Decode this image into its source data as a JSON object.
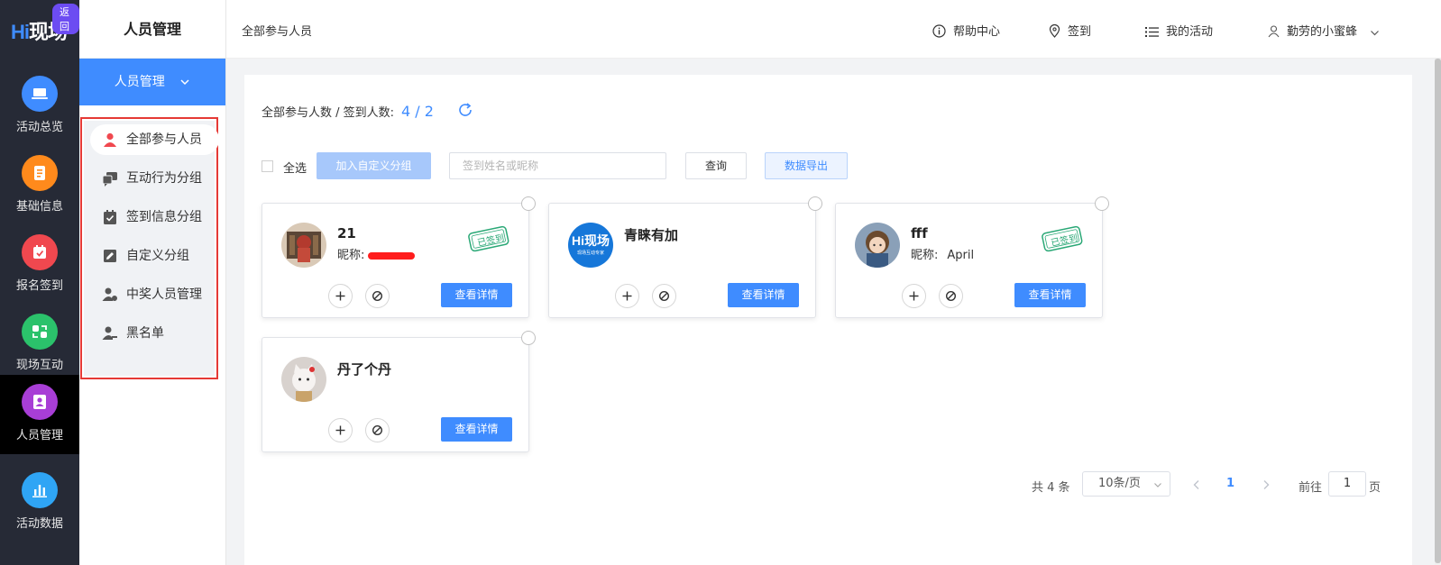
{
  "app": {
    "logo_hi": "Hi",
    "logo_rest": "现场",
    "back_label": "返回"
  },
  "rail": [
    {
      "label": "活动总览",
      "icon": "laptop-icon",
      "color": "#3f8cff"
    },
    {
      "label": "基础信息",
      "icon": "document-icon",
      "color": "#ff8a1c"
    },
    {
      "label": "报名签到",
      "icon": "calendar-check-icon",
      "color": "#f0484f"
    },
    {
      "label": "现场互动",
      "icon": "interaction-icon",
      "color": "#2bc26b"
    },
    {
      "label": "人员管理",
      "icon": "user-card-icon",
      "color": "#a83ed6",
      "active": true
    },
    {
      "label": "活动数据",
      "icon": "bar-chart-icon",
      "color": "#2fa5f5"
    }
  ],
  "submenu": {
    "title": "人员管理",
    "head": "人员管理",
    "items": [
      {
        "label": "全部参与人员",
        "icon": "user-icon",
        "active": true
      },
      {
        "label": "互动行为分组",
        "icon": "chat-group-icon"
      },
      {
        "label": "签到信息分组",
        "icon": "checkin-group-icon"
      },
      {
        "label": "自定义分组",
        "icon": "edit-group-icon"
      },
      {
        "label": "中奖人员管理",
        "icon": "prize-user-icon"
      },
      {
        "label": "黑名单",
        "icon": "blacklist-user-icon"
      }
    ]
  },
  "topbar": {
    "breadcrumb": "全部参与人员",
    "help": "帮助中心",
    "checkin": "签到",
    "my_activities": "我的活动",
    "user": "勤劳的小蜜蜂"
  },
  "stats": {
    "label": "全部参与人数 / 签到人数:",
    "value": "4 / 2"
  },
  "toolbar": {
    "select_all": "全选",
    "add_group": "加入自定义分组",
    "search_placeholder": "签到姓名或昵称",
    "query": "查询",
    "export": "数据导出"
  },
  "cards": [
    {
      "name": "21",
      "nick_label": "昵称:",
      "nick": "",
      "stamp": "已签到",
      "detail": "查看详情",
      "checked_in": true
    },
    {
      "name": "青睐有加",
      "nick_label": "",
      "nick": "",
      "stamp": "",
      "detail": "查看详情",
      "avatar_text": "Hi现场",
      "avatar_sub": "现场互动专家",
      "checked_in": false
    },
    {
      "name": "fff",
      "nick_label": "昵称:",
      "nick": "April",
      "stamp": "已签到",
      "detail": "查看详情",
      "checked_in": true
    },
    {
      "name": "丹了个丹",
      "nick_label": "",
      "nick": "",
      "stamp": "",
      "detail": "查看详情",
      "checked_in": false
    }
  ],
  "pager": {
    "total": "共 4 条",
    "page_size": "10条/页",
    "current": "1",
    "goto_label": "前往",
    "goto_value": "1",
    "page_suffix": "页"
  },
  "colors": {
    "primary": "#3f8cff",
    "rail_bg": "#262a36",
    "highlight_border": "#e53935"
  }
}
